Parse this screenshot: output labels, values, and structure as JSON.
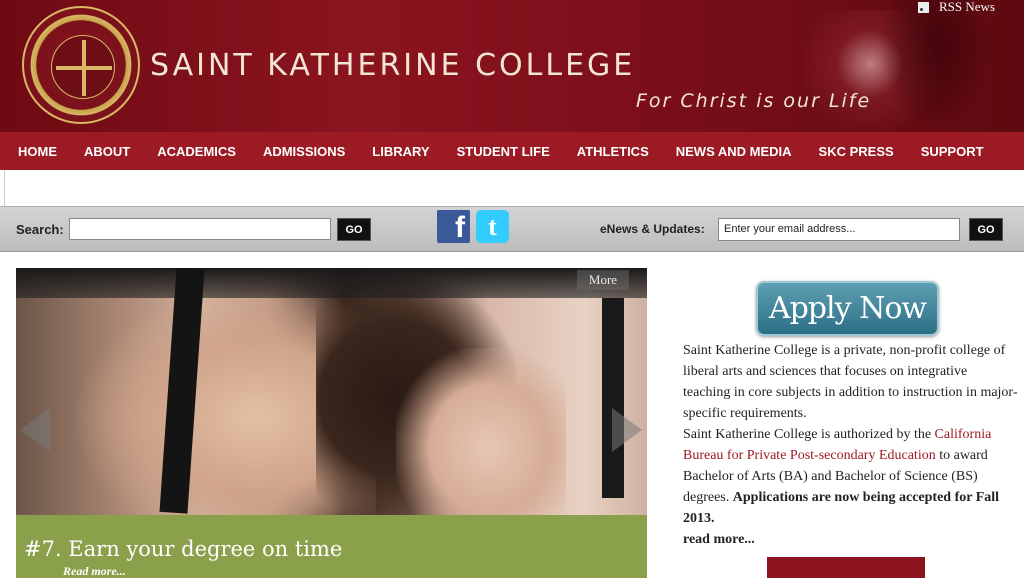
{
  "header": {
    "site_name": "SAINT KATHERINE COLLEGE",
    "tagline": "For Christ is our Life",
    "rss_label": "RSS News",
    "seal_text": "SAINT KATHERINE COLLEGE — FOR CHRIST IS OUR LIFE"
  },
  "nav": {
    "items": [
      "HOME",
      "ABOUT",
      "ACADEMICS",
      "ADMISSIONS",
      "LIBRARY",
      "STUDENT LIFE",
      "ATHLETICS",
      "NEWS AND MEDIA",
      "SKC PRESS",
      "SUPPORT"
    ]
  },
  "search": {
    "label": "Search:",
    "value": "",
    "go_label": "GO"
  },
  "social": {
    "facebook_glyph": "f",
    "twitter_glyph": "t"
  },
  "enews": {
    "label": "eNews & Updates:",
    "placeholder": "Enter your email address...",
    "go_label": "GO"
  },
  "slider": {
    "more_label": "More",
    "caption_title": "#7. Earn your degree on time",
    "caption_more": "Read more..."
  },
  "sidebar": {
    "apply_label": "Apply Now",
    "about_p1": "Saint Katherine College is a private, non-profit college of liberal arts and sciences that focuses on integrative teaching in core subjects in addition to instruction in major-specific requirements.",
    "about_p2_start": "Saint Katherine College is authorized by the ",
    "about_p2_link": "California Bureau for Private Post-secondary Education",
    "about_p2_mid": " to award Bachelor of Arts (BA) and Bachelor of Science (BS) degrees. ",
    "about_p2_bold": "Applications are now being accepted for Fall 2013.",
    "read_more": "read more..."
  },
  "colors": {
    "brand_red": "#9c1a24",
    "header_red": "#7d0f1a",
    "caption_green": "#8aa04a",
    "apply_blue": "#2c6f86"
  }
}
